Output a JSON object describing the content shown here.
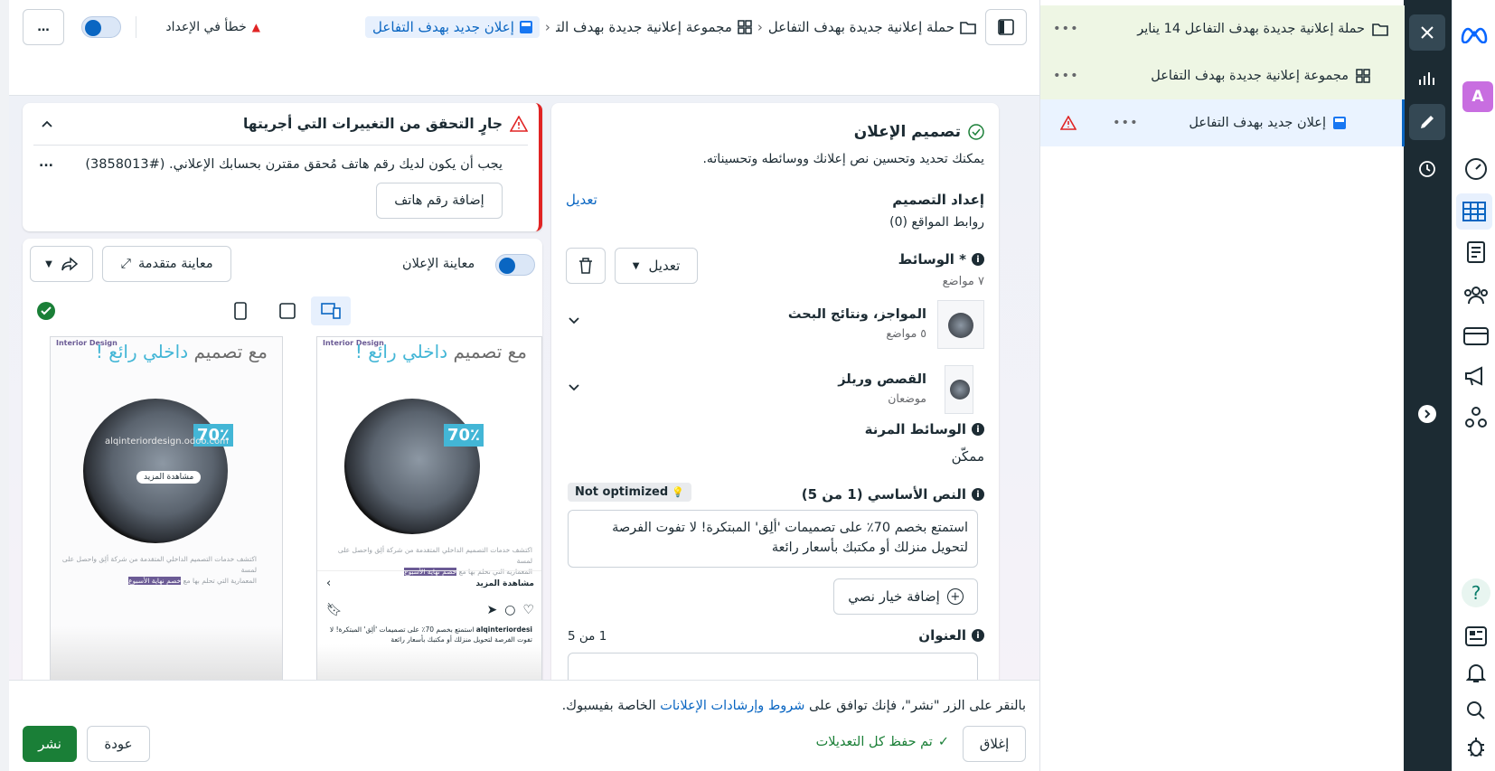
{
  "header": {
    "breadcrumb_campaign": "حملة إعلانية جديدة بهدف التفاعل",
    "breadcrumb_adset": "مجموعة إعلانية جديدة بهدف التفاعل",
    "breadcrumb_ad": "إعلان جديد بهدف التفاعل",
    "status_error": "خطأ في الإعداد",
    "more": "…"
  },
  "tree": {
    "campaign": "حملة إعلانية جديدة بهدف التفاعل 14 يناير",
    "adset": "مجموعة إعلانية جديدة بهدف التفاعل",
    "ad": "إعلان جديد بهدف التفاعل",
    "more": "•••"
  },
  "far_rail": {
    "avatar_letter": "A",
    "help": "?"
  },
  "design": {
    "title": "تصميم الإعلان",
    "subtitle": "يمكنك تحديد وتحسين نص إعلانك ووسائطه وتحسيناته.",
    "setup_label": "إعداد التصميم",
    "setup_edit": "تعديل",
    "site_links": "روابط المواقع (0)",
    "media_label": "* الوسائط",
    "media_placements": "٧ مواضع",
    "edit_button": "تعديل",
    "feeds_title": "المواجز، ونتائج البحث",
    "feeds_count": "٥ مواضع",
    "stories_title": "القصص وريلز",
    "stories_count": "موضعان",
    "flex_label": "الوسائط المرنة",
    "flex_value": "ممكّن",
    "primary_text_label": "النص الأساسي (1 من 5)",
    "not_optimized": "Not optimized",
    "primary_text_value": "استمتع بخصم 70٪ على تصميمات 'ألِق' المبتكرة! لا تفوت الفرصة لتحويل منزلك أو مكتبك بأسعار رائعة",
    "add_text_option": "إضافة خيار نصي",
    "headline_label": "العنوان",
    "headline_count": "1 من 5"
  },
  "alert": {
    "title": "جارٍ التحقق من التغييرات التي أجريتها",
    "message": "يجب أن يكون لديك رقم هاتف مُحقق مقترن بحسابك الإعلاني. (#3858013)",
    "add_phone": "إضافة رقم هاتف",
    "more": "..."
  },
  "preview": {
    "toggle_label": "معاينة الإعلان",
    "advanced": "معاينة متقدمة",
    "brand": "Interior Design",
    "headline_a": "مع تصميم ",
    "headline_b": "داخلي رائع",
    "headline_c": " !",
    "discount": "70٪",
    "site": "alqinteriordesign.odoo.com",
    "see_more_pill": "مشاهدة المزيد",
    "see_more_bar": "مشاهدة المزيد",
    "body_line1": "اكتشف خدمات التصميم الداخلي المتقدمة من شركة ألِق واحصل على لمسة",
    "body_line2": "المعمارية التي تحلم بها مع ",
    "body_highlight": "خصم نهاية الأسبوع",
    "account": "alqinteriordesi",
    "caption": "استمتع بخصم 70٪ على تصميمات 'ألِق' المبتكرة! لا تفوت الفرصة لتحويل منزلك أو مكتبك بأسعار رائعة"
  },
  "footer": {
    "terms_prefix": "بالنقر على الزر \"نشر\"، فإنك توافق على ",
    "terms_link": "شروط وإرشادات الإعلانات",
    "terms_suffix": " الخاصة بفيسبوك.",
    "close": "إغلاق",
    "saved": "تم حفظ كل التعديلات",
    "back": "عودة",
    "publish": "نشر"
  },
  "colors": {
    "primary": "#0a66c2",
    "publish": "#1a7f37",
    "error": "#e02424",
    "tree_active": "#eaf3ff",
    "tree_top": "#eef6e4"
  }
}
